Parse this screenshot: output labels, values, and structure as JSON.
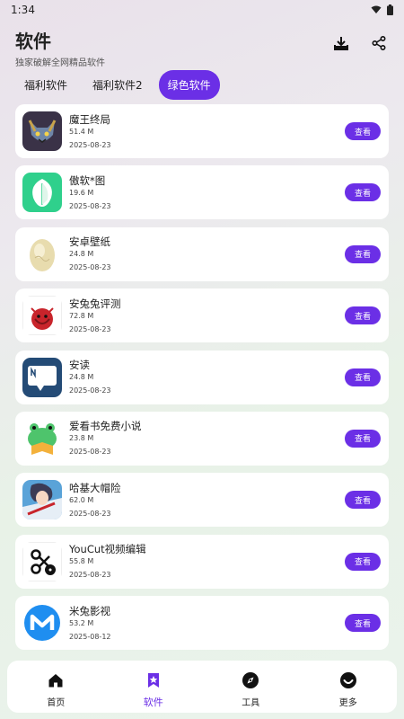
{
  "statusbar": {
    "time": "1:34"
  },
  "header": {
    "title": "软件",
    "subtitle": "独家破解全网精品软件"
  },
  "tabs": [
    {
      "label": "福利软件"
    },
    {
      "label": "福利软件2"
    },
    {
      "label": "绿色软件"
    }
  ],
  "view_label": "查看",
  "apps": [
    {
      "name": "魔王终局",
      "size": "51.4 M",
      "date": "2025-08-23",
      "icon": "demon-king-icon"
    },
    {
      "name": "傲软*图",
      "size": "19.6 M",
      "date": "2025-08-23",
      "icon": "leaf-icon"
    },
    {
      "name": "安卓壁纸",
      "size": "24.8 M",
      "date": "2025-08-23",
      "icon": "egg-icon"
    },
    {
      "name": "安兔兔评测",
      "size": "72.8 M",
      "date": "2025-08-23",
      "icon": "antutu-icon"
    },
    {
      "name": "安读",
      "size": "24.8 M",
      "date": "2025-08-23",
      "icon": "reader-icon"
    },
    {
      "name": "爱看书免费小说",
      "size": "23.8 M",
      "date": "2025-08-23",
      "icon": "frog-book-icon"
    },
    {
      "name": "哈基大帽险",
      "size": "62.0 M",
      "date": "2025-08-23",
      "icon": "anime-character-icon"
    },
    {
      "name": "YouCut视频编辑",
      "size": "55.8 M",
      "date": "2025-08-23",
      "icon": "scissors-film-icon"
    },
    {
      "name": "米兔影视",
      "size": "53.2 M",
      "date": "2025-08-12",
      "icon": "m-logo-icon"
    }
  ],
  "nav": [
    {
      "label": "首页",
      "icon": "home-icon"
    },
    {
      "label": "软件",
      "icon": "bookmark-star-icon"
    },
    {
      "label": "工具",
      "icon": "compass-icon"
    },
    {
      "label": "更多",
      "icon": "smile-icon"
    }
  ],
  "colors": {
    "accent": "#6b2fe6"
  }
}
